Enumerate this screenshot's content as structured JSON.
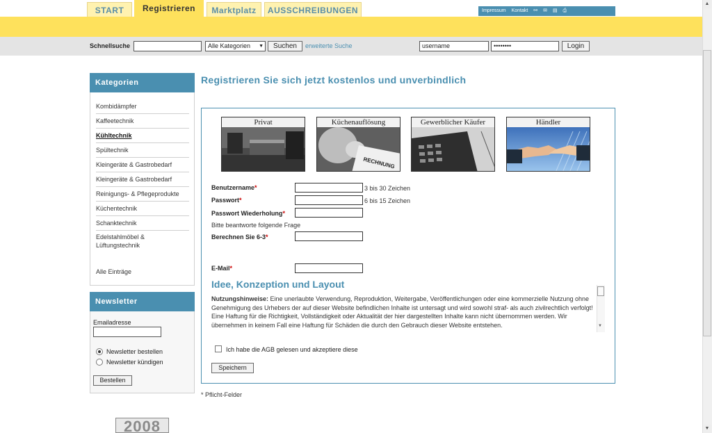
{
  "nav": {
    "tabs": [
      {
        "label": "START"
      },
      {
        "label": "Registrieren"
      },
      {
        "label": "Marktplatz"
      },
      {
        "label": "AUSSCHREIBUNGEN"
      }
    ],
    "utility": {
      "impressum": "Impressum",
      "kontakt": "Kontakt"
    }
  },
  "search": {
    "label": "Schnellsuche",
    "query": "",
    "category": "Alle Kategorien",
    "button": "Suchen",
    "advanced": "erweiterte Suche"
  },
  "login": {
    "username": "username",
    "password": "••••••••",
    "button": "Login"
  },
  "sidebar": {
    "categories_title": "Kategorien",
    "items": [
      {
        "label": "Kombidämpfer"
      },
      {
        "label": "Kaffeetechnik"
      },
      {
        "label": "Kühltechnik"
      },
      {
        "label": "Spültechnik"
      },
      {
        "label": "Kleingeräte & Gastrobedarf"
      },
      {
        "label": "Kleingeräte & Gastrobedarf"
      },
      {
        "label": "Reinigungs- & Pflegeprodukte"
      },
      {
        "label": "Küchentechnik"
      },
      {
        "label": "Schanktechnik"
      },
      {
        "label": "Edelstahlmöbel & Lüftungstechnik"
      }
    ],
    "all_entries": "Alle Einträge",
    "newsletter_title": "Newsletter",
    "email_label": "Emailadresse",
    "option_subscribe": "Newsletter bestellen",
    "option_unsubscribe": "Newsletter kündigen",
    "submit": "Bestellen",
    "badge_year": "2008"
  },
  "main": {
    "title": "Registrieren Sie sich jetzt kostenlos und unverbindlich",
    "cards": [
      {
        "label": "Privat"
      },
      {
        "label": "Küchenauflösung"
      },
      {
        "label": "Gewerblicher Käufer"
      },
      {
        "label": "Händler"
      }
    ],
    "receipt_text": "RECHNUNG",
    "fields": {
      "username_label": "Benutzername",
      "username_hint": "3 bis 30 Zeichen",
      "password_label": "Passwort",
      "password_hint": "6 bis 15 Zeichen",
      "password_repeat_label": "Passwort Wiederholung",
      "question_intro": "Bitte beantworte folgende Frage",
      "captcha_label": "Berechnen Sie 6-3",
      "email_label": "E-Mail",
      "required_mark": "*"
    },
    "terms": {
      "title": "Idee, Konzeption und Layout",
      "lead": "Nutzungshinweise:",
      "body": " Eine unerlaubte Verwendung, Reproduktion, Weitergabe, Veröffentlichungen oder eine kommerzielle Nutzung ohne Genehmigung des Urhebers der auf dieser Website befindlichen Inhalte ist untersagt und wird sowohl straf- als auch zivilrechtlich verfolgt! Eine Haftung für die Richtigkeit, Vollständigkeit oder Aktualität der hier dargestellten Inhalte kann nicht übernommen werden. Wir übernehmen in keinem Fall eine Haftung für Schäden die durch den Gebrauch dieser Website entstehen."
    },
    "agb_label": "Ich habe die AGB gelesen und akzeptiere diese",
    "save_button": "Speichern",
    "footnote": "* Pflicht-Felder"
  },
  "colors": {
    "accent_blue": "#4a8fb0",
    "brand_yellow": "#fee15c",
    "required_red": "#cc0000"
  }
}
